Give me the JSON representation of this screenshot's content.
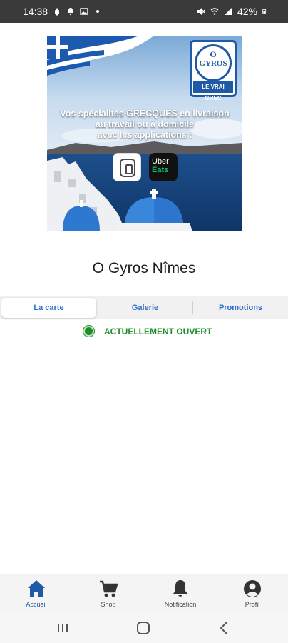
{
  "status_bar": {
    "time": "14:38",
    "battery": "42%",
    "icons_left": [
      "alarm-icon",
      "notification-bell-icon",
      "image-icon",
      "dot-icon"
    ],
    "icons_right": [
      "mute-icon",
      "wifi-icon",
      "signal-icon",
      "battery-icon"
    ]
  },
  "banner": {
    "logo_top": "O",
    "logo_name": "GYROS",
    "logo_tag": "LE VRAI GREC",
    "text_line1": "Vos spécialités GRECQUES en livraison",
    "text_line2": "au travail ou à domicile",
    "text_line3": "avec les applications :",
    "app_uber": "Uber",
    "app_eats": "Eats"
  },
  "restaurant": {
    "title": "O Gyros Nîmes"
  },
  "tabs": [
    {
      "label": "La carte",
      "active": true
    },
    {
      "label": "Galerie",
      "active": false
    },
    {
      "label": "Promotions",
      "active": false
    }
  ],
  "open_status": {
    "text": "ACTUELLEMENT OUVERT",
    "color": "#1e8e2a"
  },
  "bottom_nav": [
    {
      "label": "Accueil",
      "icon": "home-icon",
      "active": true
    },
    {
      "label": "Shop",
      "icon": "cart-icon",
      "active": false
    },
    {
      "label": "Notification",
      "icon": "bell-icon",
      "active": false
    },
    {
      "label": "Profil",
      "icon": "profile-icon",
      "active": false
    }
  ],
  "colors": {
    "accent": "#1f5aa6",
    "tab_text": "#2d6fc9",
    "open_green": "#1e8e2a"
  }
}
